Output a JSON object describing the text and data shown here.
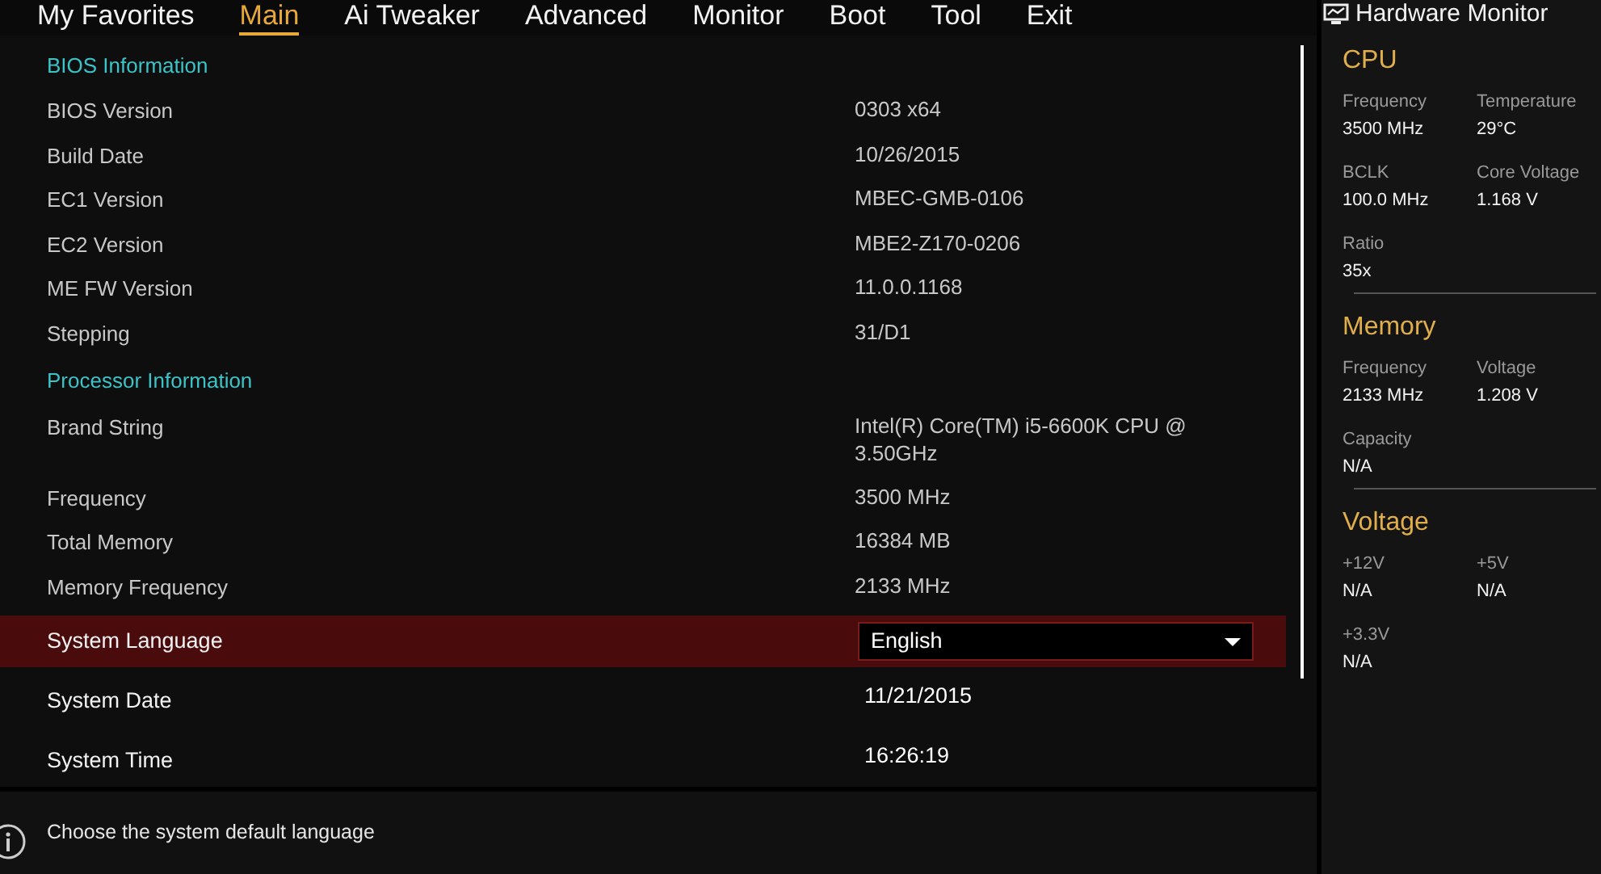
{
  "tabs": [
    {
      "label": "My Favorites",
      "selected": false
    },
    {
      "label": "Main",
      "selected": true
    },
    {
      "label": "Ai Tweaker",
      "selected": false
    },
    {
      "label": "Advanced",
      "selected": false
    },
    {
      "label": "Monitor",
      "selected": false
    },
    {
      "label": "Boot",
      "selected": false
    },
    {
      "label": "Tool",
      "selected": false
    },
    {
      "label": "Exit",
      "selected": false
    }
  ],
  "main": {
    "rows": [
      {
        "kind": "section",
        "label": "BIOS Information"
      },
      {
        "kind": "info",
        "label": "BIOS Version",
        "value": "0303 x64",
        "selected": false
      },
      {
        "kind": "info",
        "label": "Build Date",
        "value": "10/26/2015",
        "selected": false
      },
      {
        "kind": "info",
        "label": "EC1 Version",
        "value": "MBEC-GMB-0106",
        "selected": false
      },
      {
        "kind": "info",
        "label": "EC2 Version",
        "value": "MBE2-Z170-0206",
        "selected": false
      },
      {
        "kind": "info",
        "label": "ME FW Version",
        "value": "11.0.0.1168",
        "selected": false
      },
      {
        "kind": "info",
        "label": "Stepping",
        "value": "31/D1",
        "selected": false
      },
      {
        "kind": "section",
        "label": "Processor Information"
      },
      {
        "kind": "info",
        "label": "Brand String",
        "value": "Intel(R) Core(TM) i5-6600K CPU @ 3.50GHz",
        "selected": false
      },
      {
        "kind": "info",
        "label": "Frequency",
        "value": "3500 MHz",
        "selected": false
      },
      {
        "kind": "info",
        "label": "Total Memory",
        "value": "16384 MB",
        "selected": false
      },
      {
        "kind": "info",
        "label": "Memory Frequency",
        "value": "2133 MHz",
        "selected": false
      },
      {
        "kind": "dropdown",
        "label": "System Language",
        "value": "English",
        "selected": true
      },
      {
        "kind": "setting",
        "label": "System Date",
        "value": "11/21/2015",
        "selected": false
      },
      {
        "kind": "setting",
        "label": "System Time",
        "value": "16:26:19",
        "selected": false
      }
    ]
  },
  "help": {
    "text": "Choose the system default language"
  },
  "hardware_monitor": {
    "title": "Hardware Monitor",
    "sections": [
      {
        "title": "CPU",
        "items": [
          {
            "label": "Frequency",
            "value": "3500 MHz"
          },
          {
            "label": "Temperature",
            "value": "29°C"
          },
          {
            "label": "BCLK",
            "value": "100.0 MHz"
          },
          {
            "label": "Core Voltage",
            "value": "1.168 V"
          },
          {
            "label": "Ratio",
            "value": "35x"
          }
        ]
      },
      {
        "title": "Memory",
        "items": [
          {
            "label": "Frequency",
            "value": "2133 MHz"
          },
          {
            "label": "Voltage",
            "value": "1.208 V"
          },
          {
            "label": "Capacity",
            "value": "N/A"
          }
        ]
      },
      {
        "title": "Voltage",
        "items": [
          {
            "label": "+12V",
            "value": "N/A"
          },
          {
            "label": "+5V",
            "value": "N/A"
          },
          {
            "label": "+3.3V",
            "value": "N/A"
          }
        ]
      }
    ]
  }
}
